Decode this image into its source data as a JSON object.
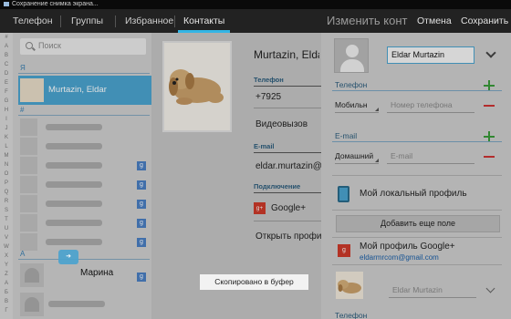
{
  "status": {
    "text": "Сохранение снимка экрана..."
  },
  "tabs": [
    {
      "label": "Телефон"
    },
    {
      "label": "Группы"
    },
    {
      "label": "Избранное"
    },
    {
      "label": "Контакты",
      "active": true
    }
  ],
  "edit_header": {
    "title": "Изменить конт",
    "cancel": "Отмена",
    "save": "Сохранить"
  },
  "alphabet": [
    "#",
    "A",
    "B",
    "C",
    "D",
    "E",
    "F",
    "G",
    "H",
    "I",
    "J",
    "K",
    "L",
    "M",
    "N",
    "O",
    "P",
    "Q",
    "R",
    "S",
    "T",
    "U",
    "V",
    "W",
    "X",
    "Y",
    "Z",
    "А",
    "Б",
    "В",
    "Г"
  ],
  "list": {
    "search_placeholder": "Поиск",
    "sections": [
      "Я",
      "#",
      "А"
    ],
    "selected_contact": "Murtazin, Eldar",
    "blurred_row_count": 7,
    "overlay_name": "Марина",
    "gplus_badge": "g"
  },
  "detail": {
    "name": "Murtazin, Eldar",
    "phone_header": "Телефон",
    "phone": "+7925",
    "video": "Видеовызов",
    "email_header": "E-mail",
    "email": "eldar.murtazin@",
    "connection_header": "Подключение",
    "gplus": "Google+",
    "gplus_icon": "g+",
    "open_profile": "Открыть профи"
  },
  "edit": {
    "name_value": "Eldar Murtazin",
    "phone_section": "Телефон",
    "phone_type": "Мобильн",
    "phone_placeholder": "Номер телефона",
    "email_section": "E-mail",
    "email_type": "Домашний",
    "email_placeholder": "E-mail",
    "local_profile": "Мой локальный профиль",
    "add_field": "Добавить еще поле",
    "gplus_profile": "Мой профиль Google+",
    "gplus_icon": "g",
    "gplus_email": "eldarmrcom@gmail.com",
    "gplus_name": "Eldar Murtazin",
    "bottom_section": "Телефон"
  },
  "toast": {
    "text": "Скопировано в буфер"
  },
  "colors": {
    "accent": "#33b5e5",
    "selected_row": "#4aa3cf",
    "plus": "#3a9a3a",
    "minus": "#cc3333",
    "gplus_red": "#cc3a2a"
  }
}
